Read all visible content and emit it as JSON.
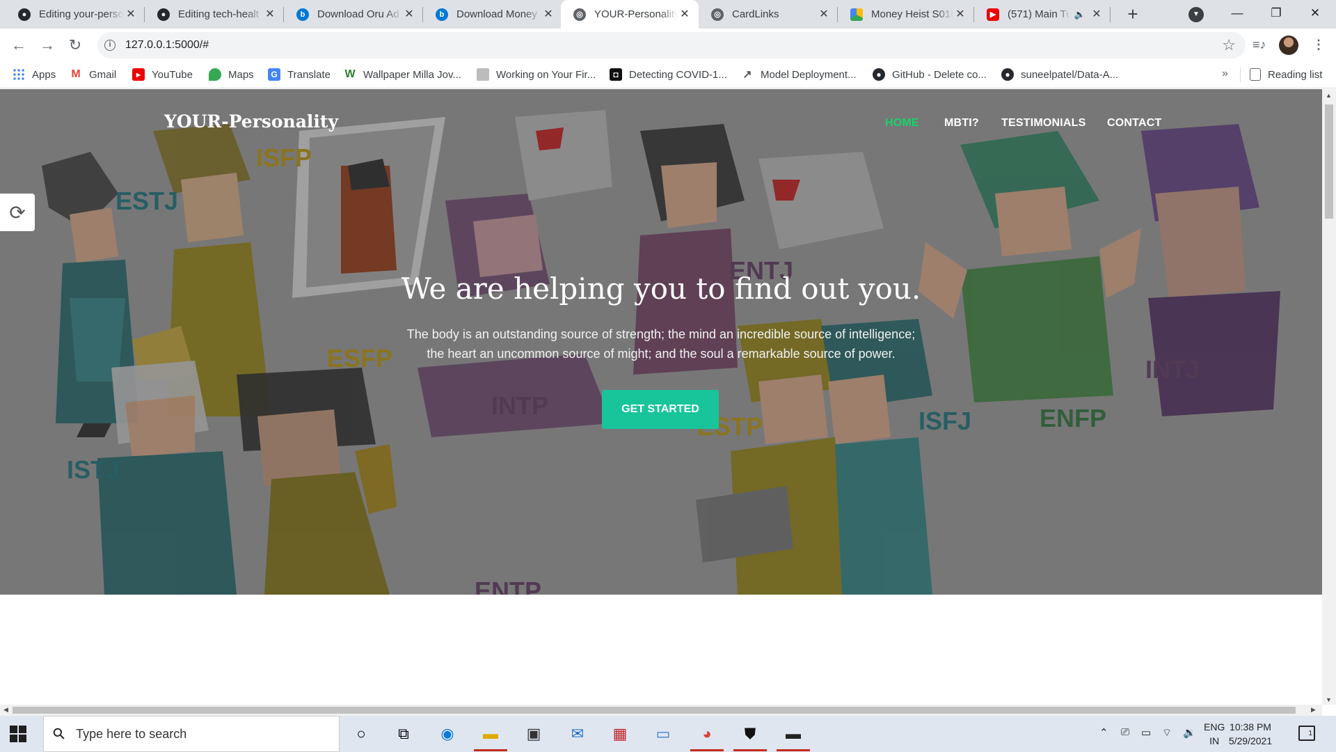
{
  "browser": {
    "tabs": [
      {
        "title": "Editing your-perso",
        "favicon": "github-icon"
      },
      {
        "title": "Editing tech-healt",
        "favicon": "github-icon"
      },
      {
        "title": "Download Oru Ad",
        "favicon": "edge-icon"
      },
      {
        "title": "Download Money",
        "favicon": "edge-icon"
      },
      {
        "title": "YOUR-Personality",
        "favicon": "globe-icon",
        "active": true
      },
      {
        "title": "CardLinks",
        "favicon": "globe-icon"
      },
      {
        "title": "Money Heist S01E",
        "favicon": "drive-icon"
      },
      {
        "title": "(571) Main Tu",
        "favicon": "youtube-icon",
        "audio": true
      }
    ],
    "url": "127.0.0.1:5000/#",
    "bookmarks": [
      {
        "label": "Apps",
        "icon": "apps-grid-icon"
      },
      {
        "label": "Gmail",
        "icon": "gmail-icon"
      },
      {
        "label": "YouTube",
        "icon": "youtube-icon"
      },
      {
        "label": "Maps",
        "icon": "maps-icon"
      },
      {
        "label": "Translate",
        "icon": "translate-icon"
      },
      {
        "label": "Wallpaper Milla Jov...",
        "icon": "w-icon"
      },
      {
        "label": "Working on Your Fir...",
        "icon": "person-icon"
      },
      {
        "label": "Detecting COVID-1...",
        "icon": "dc-icon"
      },
      {
        "label": "Model Deployment...",
        "icon": "chart-line-icon"
      },
      {
        "label": "GitHub - Delete co...",
        "icon": "github-icon"
      },
      {
        "label": "suneelpatel/Data-A...",
        "icon": "github-icon"
      }
    ],
    "reading_list": "Reading list",
    "more_bookmarks": "»"
  },
  "page": {
    "brand": "YOUR-Personality",
    "nav": [
      "HOME",
      "MBTI?",
      "TESTIMONIALS",
      "CONTACT"
    ],
    "active_nav": "HOME",
    "headline": "We are helping you to find out you.",
    "tagline_line1": "The body is an outstanding source of strength; the mind an incredible source of intelligence;",
    "tagline_line2": "the heart an uncommon source of might; and the soul a remarkable source of power.",
    "cta": "GET STARTED",
    "illustration_labels": [
      {
        "text": "ESTJ",
        "color": "#1f6b72"
      },
      {
        "text": "ISFP",
        "color": "#a88a14"
      },
      {
        "text": "ENTJ",
        "color": "#5b3a5c"
      },
      {
        "text": "ESFP",
        "color": "#a88a14"
      },
      {
        "text": "INTP",
        "color": "#5b3a5c"
      },
      {
        "text": "ESTP",
        "color": "#a88a14"
      },
      {
        "text": "ISFJ",
        "color": "#1f6b72"
      },
      {
        "text": "ENFP",
        "color": "#2e6b3a"
      },
      {
        "text": "INTJ",
        "color": "#5b3a5c"
      },
      {
        "text": "ISTJ",
        "color": "#1f6b72"
      },
      {
        "text": "ENTP",
        "color": "#5b3a5c"
      }
    ],
    "accent_color": "#18c59a",
    "active_nav_color": "#18d26e"
  },
  "taskbar": {
    "search_placeholder": "Type here to search",
    "apps": [
      "cortana-icon",
      "task-view-icon",
      "edge-icon",
      "file-explorer-icon",
      "store-icon",
      "mail-icon",
      "gift-icon",
      "network-pc-icon",
      "chrome-icon",
      "security-icon",
      "terminal-icon"
    ],
    "language": "ENG",
    "region": "IN",
    "time": "10:38 PM",
    "date": "5/29/2021",
    "notifications": "1"
  }
}
